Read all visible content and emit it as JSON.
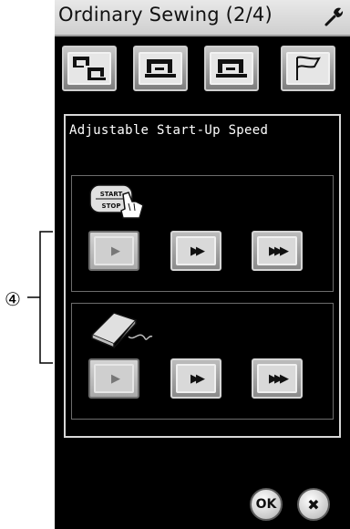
{
  "screen": {
    "title": "Ordinary Sewing (2/4)",
    "tool_icon": "wrench-icon"
  },
  "icon_tabs": [
    {
      "icon": "twin-machine-icon"
    },
    {
      "icon": "sewing-machine-icon"
    },
    {
      "icon": "sewing-machine-icon"
    },
    {
      "icon": "flag-icon"
    }
  ],
  "panel": {
    "title": "Adjustable Start-Up Speed"
  },
  "start_stop_section": {
    "icon": "start-stop-button-icon",
    "icon_text_top": "START",
    "icon_text_bottom": "STOP",
    "buttons": [
      {
        "arrows": "▶",
        "selected": true
      },
      {
        "arrows": "▶▶",
        "selected": false
      },
      {
        "arrows": "▶▶▶",
        "selected": false
      }
    ]
  },
  "foot_control_section": {
    "icon": "foot-control-icon",
    "buttons": [
      {
        "arrows": "▶",
        "selected": true
      },
      {
        "arrows": "▶▶",
        "selected": false
      },
      {
        "arrows": "▶▶▶",
        "selected": false
      }
    ]
  },
  "footer": {
    "ok_label": "OK",
    "cancel_label": "✖"
  },
  "callout": {
    "label": "④"
  }
}
